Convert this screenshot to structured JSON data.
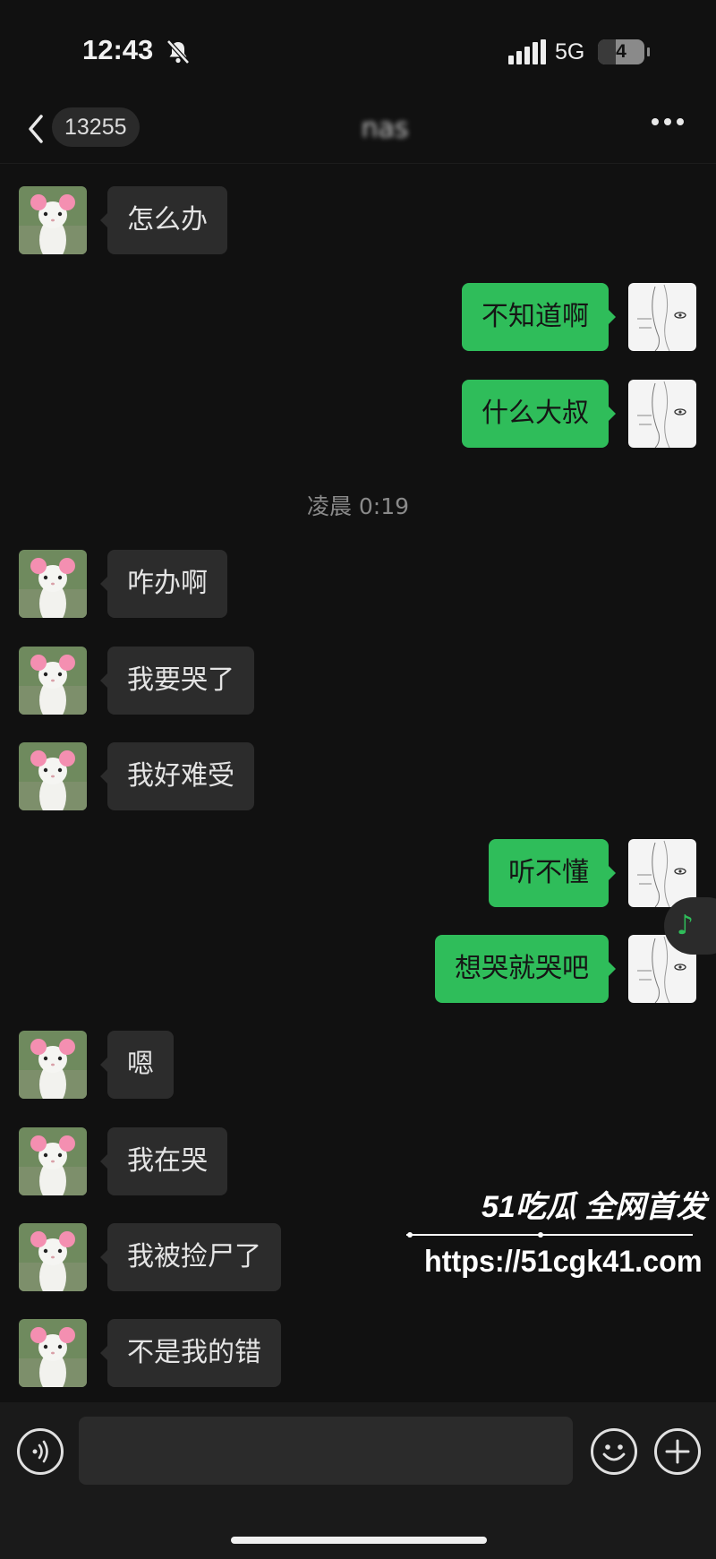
{
  "status_bar": {
    "time": "12:43",
    "network": "5G",
    "battery": "4"
  },
  "nav": {
    "back_count": "13255",
    "title": "nas"
  },
  "timestamp": "凌晨 0:19",
  "messages": [
    {
      "side": "in",
      "text": "怎么办"
    },
    {
      "side": "out",
      "text": "不知道啊"
    },
    {
      "side": "out",
      "text": "什么大叔"
    },
    {
      "side": "in",
      "text": "咋办啊"
    },
    {
      "side": "in",
      "text": "我要哭了"
    },
    {
      "side": "in",
      "text": "我好难受"
    },
    {
      "side": "out",
      "text": "听不懂"
    },
    {
      "side": "out",
      "text": "想哭就哭吧"
    },
    {
      "side": "in",
      "text": "嗯"
    },
    {
      "side": "in",
      "text": "我在哭"
    },
    {
      "side": "in",
      "text": "我被捡尸了"
    },
    {
      "side": "in",
      "text": "不是我的错"
    }
  ],
  "watermark": {
    "brand": "51吃瓜 全网首发",
    "url": "https://51cgk41.com"
  },
  "icons": {
    "muted": "bell-slash-icon",
    "back": "chevron-left-icon",
    "more": "more-dots-icon",
    "voice": "voice-icon",
    "emoji": "emoji-icon",
    "plus": "plus-icon",
    "music": "music-note-icon",
    "incoming_avatar": "cat-avatar",
    "outgoing_avatar": "sketch-avatar"
  },
  "colors": {
    "background": "#111111",
    "incoming_bubble": "#2c2c2c",
    "outgoing_bubble": "#2fbd5a"
  }
}
